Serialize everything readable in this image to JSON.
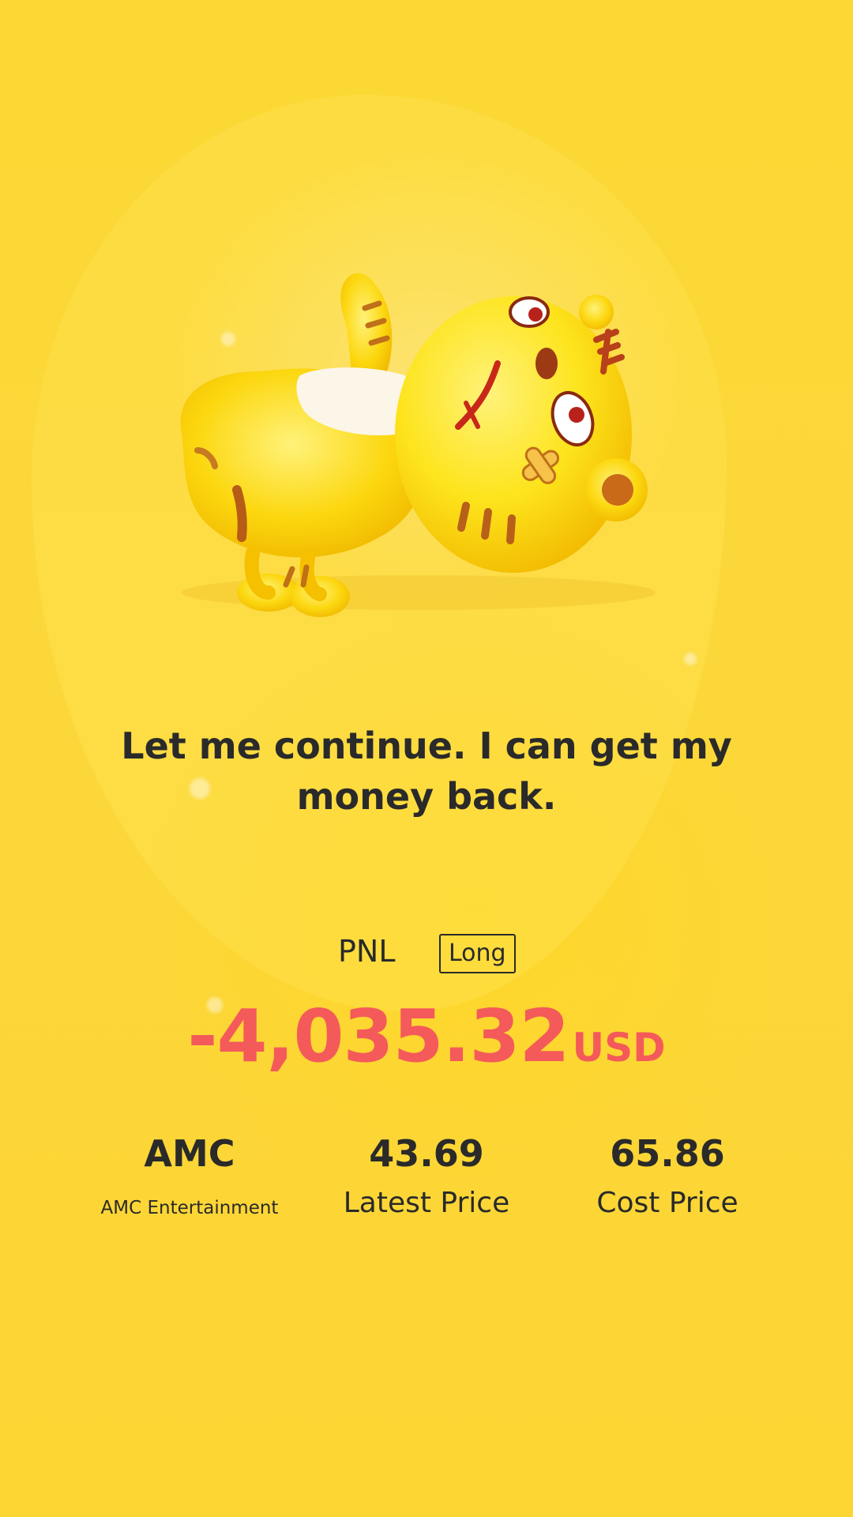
{
  "headline": "Let me continue. I can get my money back.",
  "pnl": {
    "label": "PNL",
    "position_badge": "Long",
    "value": "-4,035.32",
    "currency": "USD",
    "value_color": "#f45a5a"
  },
  "stock": {
    "ticker": "AMC",
    "name": "AMC Entertainment"
  },
  "latest_price": {
    "value": "43.69",
    "label": "Latest Price"
  },
  "cost_price": {
    "value": "65.86",
    "label": "Cost Price"
  },
  "mascot": {
    "icon": "tiger-mascot-lying-down-icon"
  },
  "colors": {
    "background": "#fcd834",
    "text": "#2a2a2a",
    "loss": "#f45a5a"
  }
}
